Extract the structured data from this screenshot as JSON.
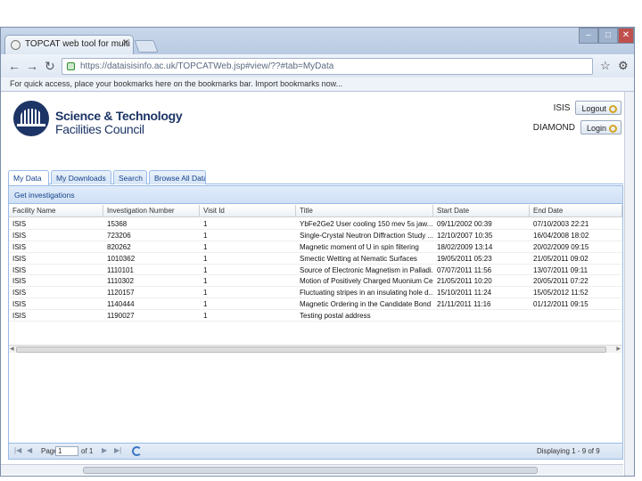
{
  "browser": {
    "tab_title": "TOPCAT web tool for multi",
    "url": "https://dataisisinfo.ac.uk/TOPCATWeb.jsp#view/??#tab=MyData",
    "bookmarks_message": "For quick access, place your bookmarks here on the bookmarks bar. Import bookmarks now..."
  },
  "header": {
    "org_line1": "Science & Technology",
    "org_line2": "Facilities Council",
    "facilities": [
      {
        "name": "ISIS",
        "button": "Logout"
      },
      {
        "name": "DIAMOND",
        "button": "Login"
      }
    ]
  },
  "tabs": [
    "My Data",
    "My Downloads",
    "Search",
    "Browse All Data"
  ],
  "panel_title": "Get investigations",
  "columns": [
    "Facility Name",
    "Investigation Number",
    "Visit Id",
    "Title",
    "Start Date",
    "End Date"
  ],
  "rows": [
    [
      "ISIS",
      "15368",
      "1",
      "YbFe2Ge2 User cooling 150 mev 5s jaw...",
      "09/11/2002 00:39",
      "07/10/2003 22:21"
    ],
    [
      "ISIS",
      "723206",
      "1",
      "Single-Crystal Neutron Diffraction Study ...",
      "12/10/2007 10:35",
      "16/04/2008 18:02"
    ],
    [
      "ISIS",
      "820262",
      "1",
      "Magnetic moment of U in spin filtering",
      "18/02/2009 13:14",
      "20/02/2009 09:15"
    ],
    [
      "ISIS",
      "1010362",
      "1",
      "Smectic Wetting at Nematic Surfaces",
      "19/05/2011 05:23",
      "21/05/2011 09:02"
    ],
    [
      "ISIS",
      "1110101",
      "1",
      "Source of Electronic Magnetism in Palladi...",
      "07/07/2011 11:56",
      "13/07/2011 09:11"
    ],
    [
      "ISIS",
      "1110302",
      "1",
      "Motion of Positively Charged Muonium Ce...",
      "21/05/2011 10:20",
      "20/05/2011 07:22"
    ],
    [
      "ISIS",
      "1120157",
      "1",
      "Fluctuating stripes in an insulating hole d...",
      "15/10/2011 11:24",
      "15/05/2012 11:52"
    ],
    [
      "ISIS",
      "1140444",
      "1",
      "Magnetic Ordering in the Candidate Bond",
      "21/11/2011 11:16",
      "01/12/2011 09:15"
    ],
    [
      "ISIS",
      "1190027",
      "1",
      "Testing postal address",
      "",
      ""
    ]
  ],
  "pager": {
    "page_label": "Page",
    "page_value": "1",
    "of_label": "of 1",
    "displaying": "Displaying 1 - 9 of 9"
  }
}
